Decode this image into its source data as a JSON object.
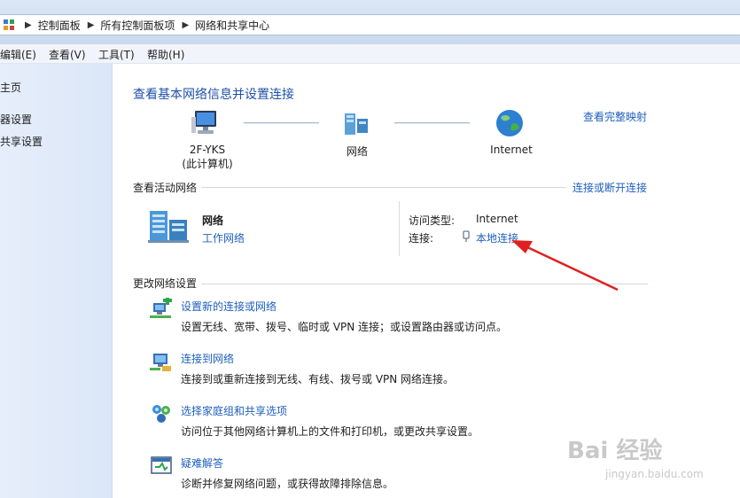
{
  "address_bar": {
    "breadcrumbs": [
      "控制面板",
      "所有控制面板项",
      "网络和共享中心"
    ]
  },
  "menu": [
    "编辑(E)",
    "查看(V)",
    "工具(T)",
    "帮助(H)"
  ],
  "sidebar": {
    "items": [
      "主页",
      "器设置",
      "共享设置"
    ]
  },
  "main": {
    "title": "查看基本网络信息并设置连接",
    "view_full_map": "查看完整映射",
    "map": {
      "computer_name": "2F-YKS",
      "computer_sub": "(此计算机)",
      "network_label": "网络",
      "internet_label": "Internet"
    },
    "active": {
      "heading": "查看活动网络",
      "connect_disconnect": "连接或断开连接",
      "network_name": "网络",
      "network_type": "工作网络",
      "access_type_label": "访问类型:",
      "access_type_value": "Internet",
      "connections_label": "连接:",
      "connection_link": "本地连接"
    },
    "change": {
      "heading": "更改网络设置",
      "tasks": [
        {
          "title": "设置新的连接或网络",
          "desc": "设置无线、宽带、拨号、临时或 VPN 连接；或设置路由器或访问点。"
        },
        {
          "title": "连接到网络",
          "desc": "连接到或重新连接到无线、有线、拨号或 VPN 网络连接。"
        },
        {
          "title": "选择家庭组和共享选项",
          "desc": "访问位于其他网络计算机上的文件和打印机，或更改共享设置。"
        },
        {
          "title": "疑难解答",
          "desc": "诊断并修复网络问题，或获得故障排除信息。"
        }
      ]
    }
  },
  "watermark": {
    "brand": "Bai 经验",
    "url": "jingyan.baidu.com"
  },
  "colors": {
    "link": "#1f5fbd",
    "title": "#1e4fa8",
    "annotation_arrow": "#e02020"
  }
}
